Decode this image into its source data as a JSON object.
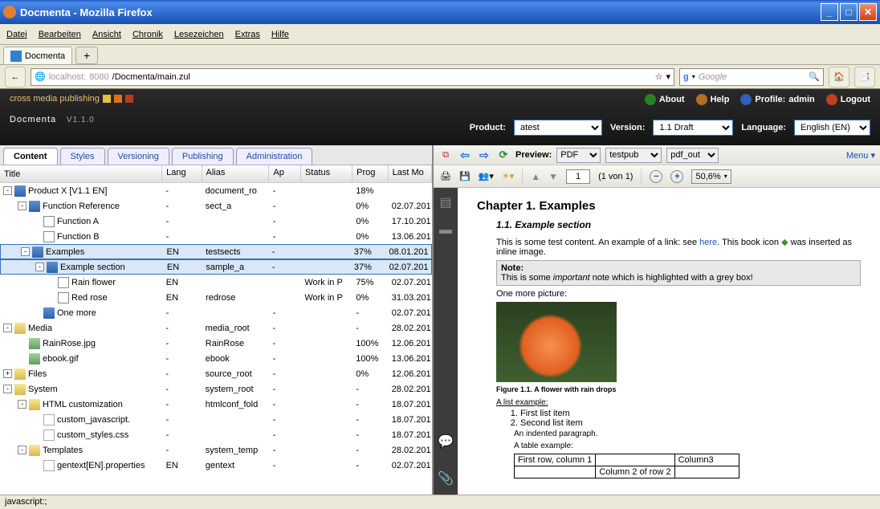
{
  "window_title": "Docmenta - Mozilla Firefox",
  "browser_menu": [
    "Datei",
    "Bearbeiten",
    "Ansicht",
    "Chronik",
    "Lesezeichen",
    "Extras",
    "Hilfe"
  ],
  "browser_tab": "Docmenta",
  "url": {
    "host": "localhost:",
    "port": "8080",
    "path": "/Docmenta/main.zul"
  },
  "search_placeholder": "Google",
  "app": {
    "tagline": "cross media publishing",
    "brand": "Docmenta",
    "version": "V1.1.0",
    "top_links": {
      "about": "About",
      "help": "Help",
      "profile_label": "Profile:",
      "profile_value": "admin",
      "logout": "Logout"
    },
    "selectors": {
      "product_label": "Product:",
      "product_value": "atest",
      "version_label": "Version:",
      "version_value": "1.1 Draft",
      "language_label": "Language:",
      "language_value": "English (EN)"
    }
  },
  "tabs": [
    "Content",
    "Styles",
    "Versioning",
    "Publishing",
    "Administration"
  ],
  "active_tab": "Content",
  "grid": {
    "columns": [
      "Title",
      "Lang",
      "Alias",
      "Ap",
      "Status",
      "Prog",
      "Last Mo"
    ],
    "rows": [
      {
        "indent": 0,
        "exp": "-",
        "icon": "book",
        "title": "Product X [V1.1 EN]",
        "lang": "-",
        "alias": "document_ro",
        "ap": "-",
        "status": "",
        "prog": "18%",
        "last": ""
      },
      {
        "indent": 1,
        "exp": "-",
        "icon": "book",
        "title": "Function Reference",
        "lang": "-",
        "alias": "sect_a",
        "ap": "-",
        "status": "",
        "prog": "0%",
        "last": "02.07.201"
      },
      {
        "indent": 2,
        "exp": "",
        "icon": "page",
        "title": "Function A",
        "lang": "-",
        "alias": "",
        "ap": "-",
        "status": "",
        "prog": "0%",
        "last": "17.10.201"
      },
      {
        "indent": 2,
        "exp": "",
        "icon": "page",
        "title": "Function B",
        "lang": "-",
        "alias": "",
        "ap": "-",
        "status": "",
        "prog": "0%",
        "last": "13.06.201"
      },
      {
        "indent": 1,
        "exp": "-",
        "icon": "book",
        "title": "Examples",
        "lang": "EN",
        "alias": "testsects",
        "ap": "-",
        "status": "",
        "prog": "37%",
        "last": "08.01.201",
        "sel": true
      },
      {
        "indent": 2,
        "exp": "-",
        "icon": "book",
        "title": "Example section",
        "lang": "EN",
        "alias": "sample_a",
        "ap": "-",
        "status": "",
        "prog": "37%",
        "last": "02.07.201",
        "sel": true
      },
      {
        "indent": 3,
        "exp": "",
        "icon": "page",
        "title": "Rain flower",
        "lang": "EN",
        "alias": "",
        "ap": "",
        "status": "Work in P",
        "prog": "75%",
        "last": "02.07.201"
      },
      {
        "indent": 3,
        "exp": "",
        "icon": "page",
        "title": "Red rose",
        "lang": "EN",
        "alias": "redrose",
        "ap": "",
        "status": "Work in P",
        "prog": "0%",
        "last": "31.03.201"
      },
      {
        "indent": 2,
        "exp": "",
        "icon": "book",
        "title": "One more",
        "lang": "-",
        "alias": "",
        "ap": "-",
        "status": "",
        "prog": "-",
        "last": "02.07.201"
      },
      {
        "indent": 0,
        "exp": "-",
        "icon": "folder",
        "title": "Media",
        "lang": "-",
        "alias": "media_root",
        "ap": "-",
        "status": "",
        "prog": "-",
        "last": "28.02.201"
      },
      {
        "indent": 1,
        "exp": "",
        "icon": "img",
        "title": "RainRose.jpg",
        "lang": "-",
        "alias": "RainRose",
        "ap": "-",
        "status": "",
        "prog": "100%",
        "last": "12.06.201"
      },
      {
        "indent": 1,
        "exp": "",
        "icon": "img",
        "title": "ebook.gif",
        "lang": "-",
        "alias": "ebook",
        "ap": "-",
        "status": "",
        "prog": "100%",
        "last": "13.06.201"
      },
      {
        "indent": 0,
        "exp": "+",
        "icon": "folder",
        "title": "Files",
        "lang": "-",
        "alias": "source_root",
        "ap": "-",
        "status": "",
        "prog": "0%",
        "last": "12.06.201"
      },
      {
        "indent": 0,
        "exp": "-",
        "icon": "folder",
        "title": "System",
        "lang": "-",
        "alias": "system_root",
        "ap": "-",
        "status": "",
        "prog": "-",
        "last": "28.02.201"
      },
      {
        "indent": 1,
        "exp": "-",
        "icon": "folder",
        "title": "HTML customization",
        "lang": "-",
        "alias": "htmlconf_fold",
        "ap": "-",
        "status": "",
        "prog": "-",
        "last": "18.07.201"
      },
      {
        "indent": 2,
        "exp": "",
        "icon": "file",
        "title": "custom_javascript.",
        "lang": "-",
        "alias": "",
        "ap": "-",
        "status": "",
        "prog": "-",
        "last": "18.07.201"
      },
      {
        "indent": 2,
        "exp": "",
        "icon": "file",
        "title": "custom_styles.css",
        "lang": "-",
        "alias": "",
        "ap": "-",
        "status": "",
        "prog": "-",
        "last": "18.07.201"
      },
      {
        "indent": 1,
        "exp": "-",
        "icon": "folder",
        "title": "Templates",
        "lang": "-",
        "alias": "system_temp",
        "ap": "-",
        "status": "",
        "prog": "-",
        "last": "28.02.201"
      },
      {
        "indent": 2,
        "exp": "",
        "icon": "file",
        "title": "gentext[EN].properties",
        "lang": "EN",
        "alias": "gentext",
        "ap": "-",
        "status": "",
        "prog": "-",
        "last": "02.07.201"
      }
    ]
  },
  "preview_bar": {
    "label": "Preview:",
    "format": "PDF",
    "pub": "testpub",
    "out": "pdf_out",
    "menu": "Menu"
  },
  "pdf_toolbar": {
    "page_num": "1",
    "page_count": "(1 von 1)",
    "zoom": "50,6%"
  },
  "pdf_content": {
    "h1": "Chapter 1. Examples",
    "h2": "1.1. Example section",
    "p1a": "This is some test content. An example of a link: see ",
    "p1link": "here",
    "p1b": ". This book icon",
    "p1c": " was inserted as inline image.",
    "note_label": "Note:",
    "note_body_a": "This is some ",
    "note_body_i": "important",
    "note_body_b": " note which is highlighted with a grey box!",
    "p2": "One more picture:",
    "figcap": "Figure 1.1. A flower with rain drops",
    "listex": "A list example:",
    "li1": "First list item",
    "li2": "Second list item",
    "indent": "An indented paragraph.",
    "tableex": "A table example:",
    "t_r1c1": "First row, column 1",
    "t_r1c3": "Column3",
    "t_r2c2": "Column 2 of row 2"
  },
  "statusbar": "javascript:;"
}
